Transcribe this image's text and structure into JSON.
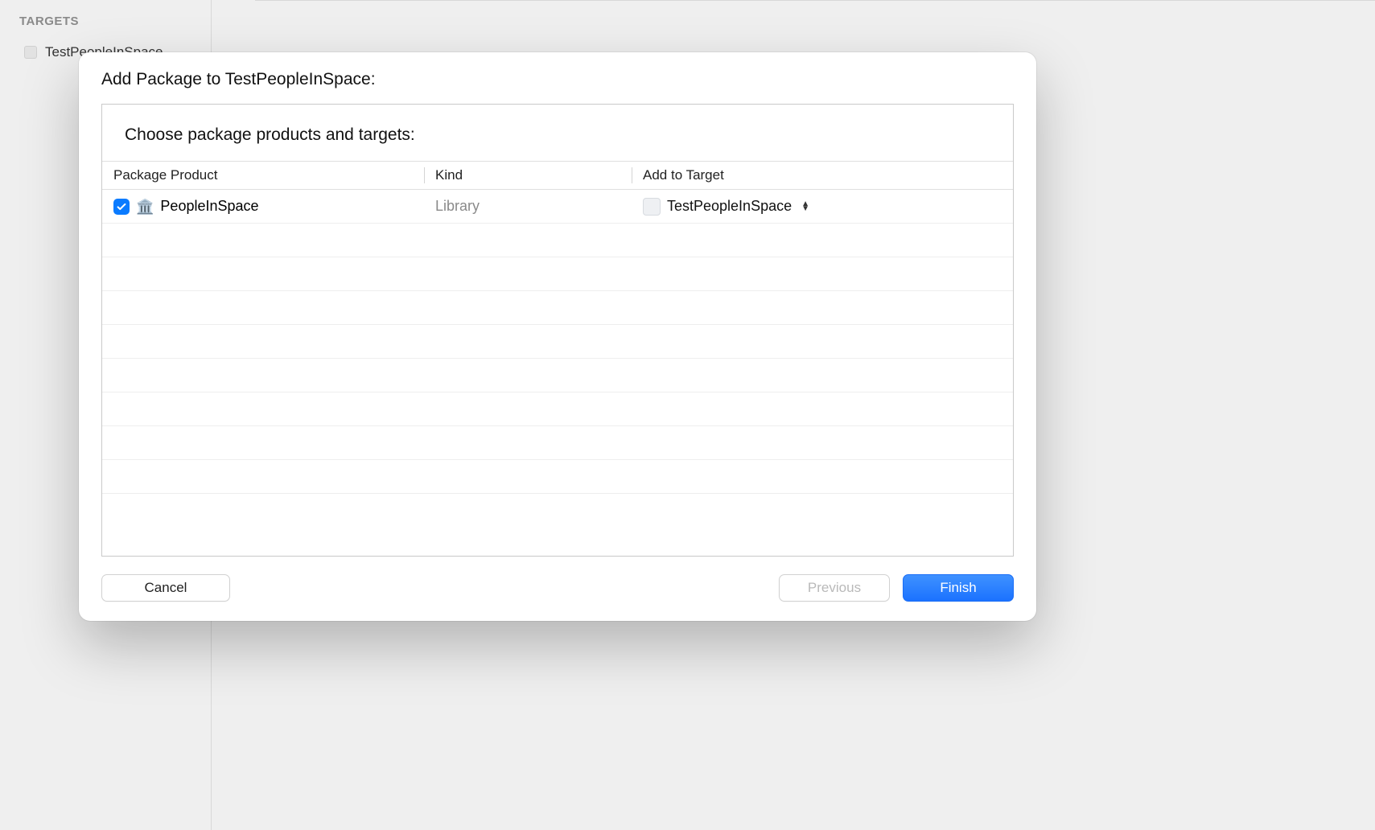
{
  "sidebar": {
    "section_title": "TARGETS",
    "items": [
      {
        "label": "TestPeopleInSpace"
      }
    ]
  },
  "sheet": {
    "title": "Add Package to TestPeopleInSpace:",
    "subtitle": "Choose package products and targets:",
    "columns": {
      "product": "Package Product",
      "kind": "Kind",
      "target": "Add to Target"
    },
    "rows": [
      {
        "checked": true,
        "product_name": "PeopleInSpace",
        "kind": "Library",
        "target": "TestPeopleInSpace"
      }
    ],
    "buttons": {
      "cancel": "Cancel",
      "previous": "Previous",
      "finish": "Finish"
    }
  }
}
